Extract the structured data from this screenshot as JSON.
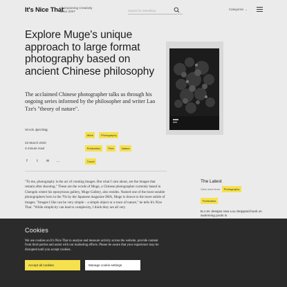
{
  "header": {
    "logo": "It's Nice That",
    "tagline": "Championing Creativity Since 2007",
    "search_placeholder": "Search for something",
    "categories_label": "Categories",
    "categories_chevron": "⌄"
  },
  "article": {
    "title": "Explore Muge's unique approach to large format photography based on ancient Chinese philosophy",
    "standfirst": "The acclaimed Chinese photographer talks us through his ongoing series informed by the philosopher and writer Lao Tze's \"theory of nature\".",
    "words_label": "Words",
    "author": "Jyni Ong",
    "date": "23 March 2020",
    "read_time": "3 minute read",
    "tags": [
      "Work",
      "Photography",
      "Publication",
      "Print",
      "Nature",
      "Travel"
    ],
    "share": [
      "f",
      "t",
      "✉",
      "…"
    ],
    "body": "\"To me, photography is the act of creating images. But what I care about, are the images that remain after shooting.\" These are the words of Muge, a Chinese photographer currently based in Chengdu where his eponymous gallery, Muge Gallery, also resides. Named one of the most notable photographers born in the 70s by the Japanese magazine IMA, Muge is drawn to the more subtle of images. \"Images I like can be very simple – a simple object or a trace of nature,\" he tells It's Nice That. \"While simplicity can lead to complexity, I think they are all very"
  },
  "sidebar": {
    "latest_title": "The Latest",
    "view_more_label": "View more from",
    "filter_tags": [
      "Photography",
      "Publication"
    ],
    "latest_item": "B.A.M. designs new Lou Stoppard book on swimming pools in"
  },
  "cookie_banner": {
    "title": "Cookies",
    "text": "We use cookies on It's Nice That to analyse and measure activity across the website, provide content from third parties and assist with our marketing efforts. Please be aware that your experience may be disrupted until you accept cookies.",
    "accept_label": "Accept all cookies",
    "manage_label": "Manage cookie settings"
  },
  "colors": {
    "accent": "#f5e14d",
    "background": "#ebebeb",
    "banner": "#2b2b2b"
  }
}
